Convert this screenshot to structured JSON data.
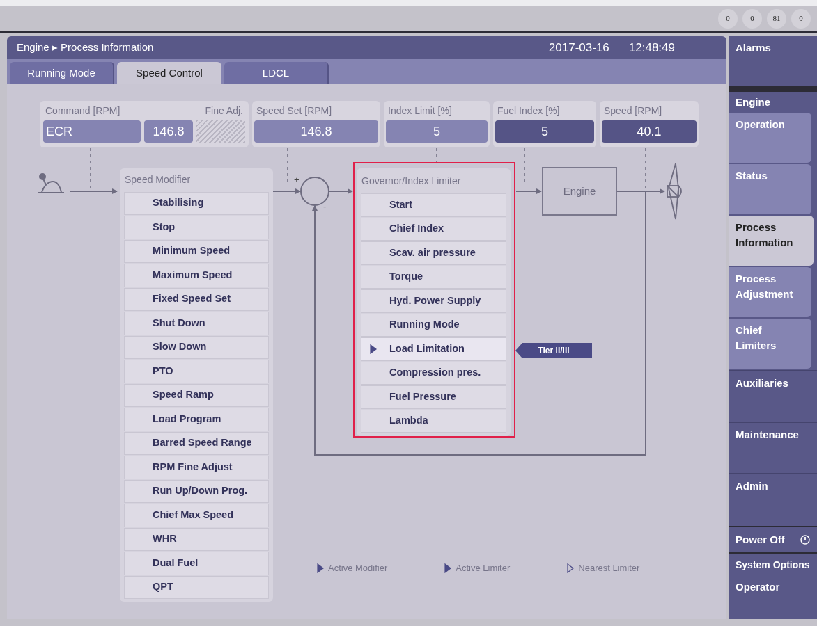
{
  "status_counters": [
    "0",
    "0",
    "81",
    "0"
  ],
  "header": {
    "breadcrumb": "Engine ▸ Process Information",
    "date": "2017-03-16",
    "time": "12:48:49"
  },
  "tabs": [
    {
      "label": "Running Mode",
      "selected": false
    },
    {
      "label": "Speed Control",
      "selected": true
    },
    {
      "label": "LDCL",
      "selected": false
    }
  ],
  "command": {
    "label": "Command [RPM]",
    "fine_label": "Fine Adj.",
    "source": "ECR",
    "value": "146.8"
  },
  "readouts": [
    {
      "label": "Speed Set [RPM]",
      "value": "146.8",
      "emphasis": false
    },
    {
      "label": "Index Limit [%]",
      "value": "5",
      "emphasis": false
    },
    {
      "label": "Fuel Index [%]",
      "value": "5",
      "emphasis": true
    },
    {
      "label": "Speed [RPM]",
      "value": "40.1",
      "emphasis": true
    }
  ],
  "sum_signs": {
    "plus": "+",
    "minus": "-"
  },
  "speed_modifier": {
    "title": "Speed Modifier",
    "items": [
      {
        "label": "Stabilising",
        "active": false
      },
      {
        "label": "Stop",
        "active": false
      },
      {
        "label": "Minimum Speed",
        "active": false
      },
      {
        "label": "Maximum Speed",
        "active": false
      },
      {
        "label": "Fixed Speed Set",
        "active": false
      },
      {
        "label": "Shut Down",
        "active": false
      },
      {
        "label": "Slow Down",
        "active": false
      },
      {
        "label": "PTO",
        "active": false
      },
      {
        "label": "Speed Ramp",
        "active": false
      },
      {
        "label": "Load Program",
        "active": false
      },
      {
        "label": "Barred Speed Range",
        "active": false
      },
      {
        "label": "RPM Fine Adjust",
        "active": false
      },
      {
        "label": "Run Up/Down Prog.",
        "active": false
      },
      {
        "label": "Chief Max Speed",
        "active": false
      },
      {
        "label": "WHR",
        "active": false
      },
      {
        "label": "Dual Fuel",
        "active": false
      },
      {
        "label": "QPT",
        "active": false
      }
    ]
  },
  "governor": {
    "title": "Governor/Index Limiter",
    "items": [
      {
        "label": "Start",
        "active": false
      },
      {
        "label": "Chief Index",
        "active": false
      },
      {
        "label": "Scav. air pressure",
        "active": false
      },
      {
        "label": "Torque",
        "active": false
      },
      {
        "label": "Hyd. Power Supply",
        "active": false
      },
      {
        "label": "Running Mode",
        "active": false
      },
      {
        "label": "Load Limitation",
        "active": true
      },
      {
        "label": "Compression pres.",
        "active": false
      },
      {
        "label": "Fuel Pressure",
        "active": false
      },
      {
        "label": "Lambda",
        "active": false
      }
    ]
  },
  "limit_tag": "Tier II/III",
  "engine_label": "Engine",
  "legend": [
    {
      "label": "Active Modifier",
      "kind": "active_modifier"
    },
    {
      "label": "Active Limiter",
      "kind": "active_limiter"
    },
    {
      "label": "Nearest Limiter",
      "kind": "nearest_limiter"
    }
  ],
  "sidebar": {
    "alarms": "Alarms",
    "section": "Engine",
    "items": [
      {
        "label": "Operation",
        "selected": false,
        "kind": "sub"
      },
      {
        "label": "Status",
        "selected": false,
        "kind": "sub"
      },
      {
        "label": "Process Information",
        "selected": true,
        "kind": "sub"
      },
      {
        "label": "Process Adjustment",
        "selected": false,
        "kind": "sub"
      },
      {
        "label": "Chief Limiters",
        "selected": false,
        "kind": "sub"
      },
      {
        "label": "Auxiliaries",
        "selected": false,
        "kind": "main"
      },
      {
        "label": "Maintenance",
        "selected": false,
        "kind": "main"
      },
      {
        "label": "Admin",
        "selected": false,
        "kind": "main"
      }
    ],
    "power_off": "Power Off",
    "system_options": "System Options",
    "operator": "Operator"
  }
}
